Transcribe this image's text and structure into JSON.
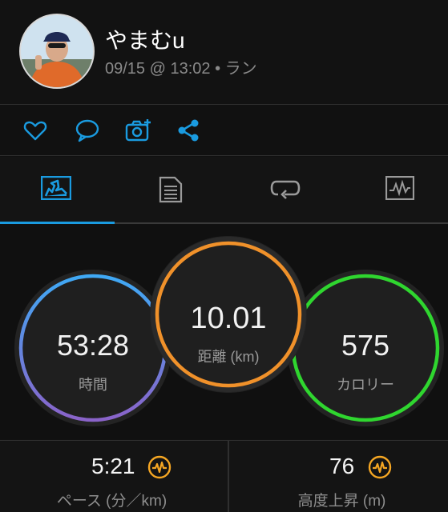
{
  "activity": {
    "user_name": "やまむu",
    "meta": "09/15 @ 13:02 • ラン"
  },
  "actions": [
    {
      "icon": "heart-icon"
    },
    {
      "icon": "comment-icon"
    },
    {
      "icon": "add-photo-icon"
    },
    {
      "icon": "share-icon"
    }
  ],
  "tabs": [
    {
      "icon": "stats-tab-icon",
      "active": true
    },
    {
      "icon": "details-tab-icon"
    },
    {
      "icon": "laps-tab-icon"
    },
    {
      "icon": "chart-tab-icon"
    }
  ],
  "stats": {
    "time": {
      "value": "53:28",
      "label": "時間"
    },
    "distance": {
      "value": "10.01",
      "label": "距離 (km)"
    },
    "calories": {
      "value": "575",
      "label": "カロリー"
    }
  },
  "summary": {
    "pace": {
      "value": "5:21",
      "label": "ペース (分／km)"
    },
    "elevation": {
      "value": "76",
      "label": "高度上昇 (m)"
    }
  },
  "colors": {
    "accent": "#1a9be0",
    "time_ring_top": "#3fa9f5",
    "time_ring_bottom": "#8a63c9",
    "distance_ring": "#f0912a",
    "calories_ring": "#2fd62f",
    "metric_icon": "#f5a623"
  }
}
